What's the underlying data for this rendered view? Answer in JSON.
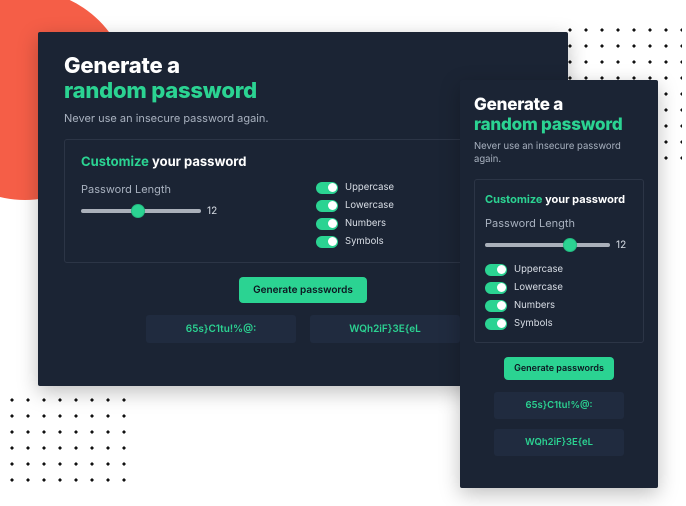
{
  "colors": {
    "accent": "#2bd392",
    "background": "#1b2434",
    "coral": "#f55e47"
  },
  "heading": {
    "line1": "Generate a",
    "line2": "random password"
  },
  "subheading": "Never use an insecure password again.",
  "customize": {
    "title_highlight": "Customize",
    "title_rest": " your password",
    "length_label": "Password Length",
    "length_value": "12",
    "toggles": [
      {
        "label": "Uppercase",
        "on": true
      },
      {
        "label": "Lowercase",
        "on": true
      },
      {
        "label": "Numbers",
        "on": true
      },
      {
        "label": "Symbols",
        "on": true
      }
    ]
  },
  "generate_button": "Generate passwords",
  "outputs": [
    "65s}C1tu!%@:",
    "WQh2iF}3E{eL"
  ]
}
